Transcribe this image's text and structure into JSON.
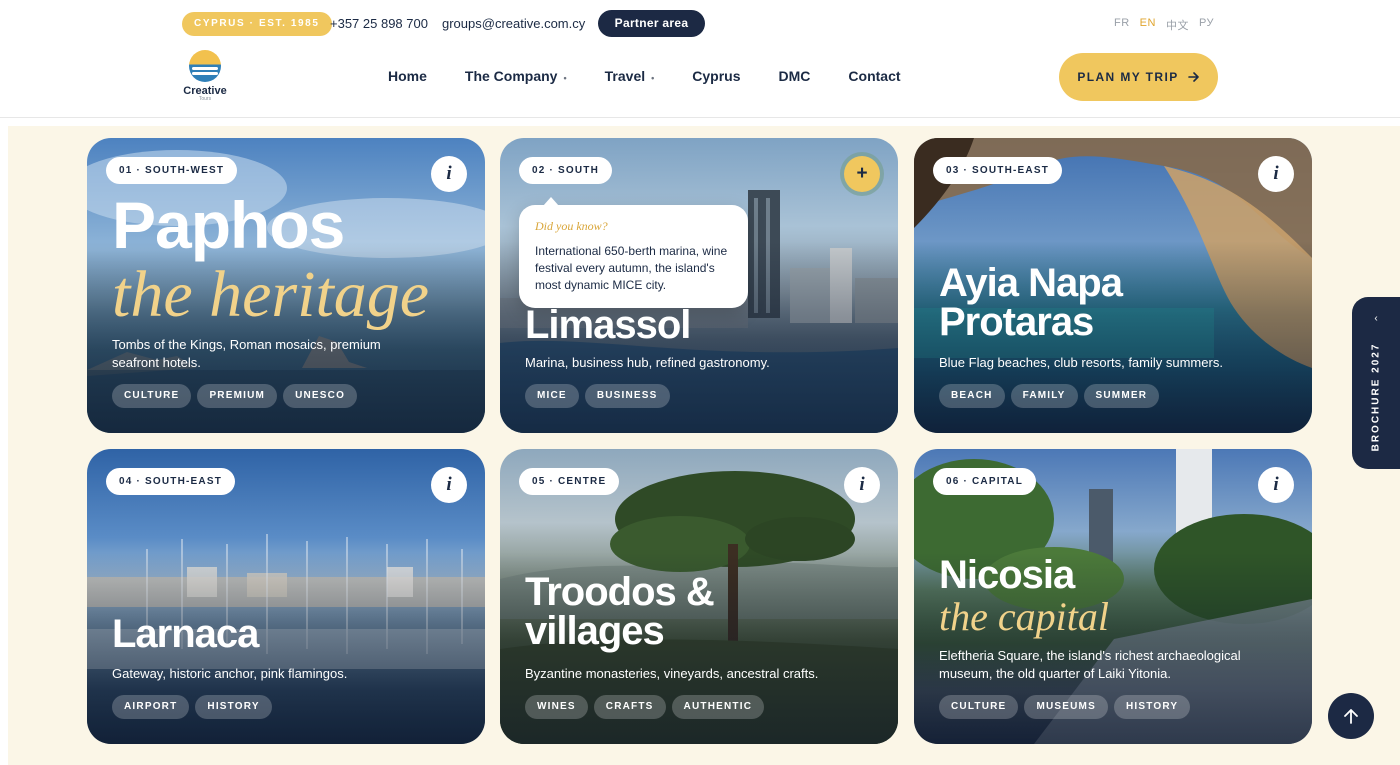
{
  "header": {
    "badge": "CYPRUS · EST. 1985",
    "phone": "+357 25 898 700",
    "email": "groups@creative.com.cy",
    "partner_label": "Partner area",
    "languages": [
      {
        "code": "FR",
        "active": false
      },
      {
        "code": "EN",
        "active": true
      },
      {
        "code": "中文",
        "active": false
      },
      {
        "code": "РУ",
        "active": false
      }
    ],
    "logo": {
      "name": "Creative",
      "sub": "Tours"
    },
    "nav": [
      {
        "label": "Home",
        "has_submenu": false
      },
      {
        "label": "The Company",
        "has_submenu": true
      },
      {
        "label": "Travel",
        "has_submenu": true
      },
      {
        "label": "Cyprus",
        "has_submenu": false
      },
      {
        "label": "DMC",
        "has_submenu": false
      },
      {
        "label": "Contact",
        "has_submenu": false
      }
    ],
    "cta_label": "PLAN MY TRIP",
    "cta_icon": "arrow-right-icon"
  },
  "cards": [
    {
      "tag": "01 · SOUTH-WEST",
      "title": "Paphos",
      "script": "the heritage",
      "desc": "Tombs of the Kings, Roman mosaics, premium seafront hotels.",
      "chips": [
        "CULTURE",
        "PREMIUM",
        "UNESCO"
      ],
      "action_icon": "info-icon",
      "action_glyph": "i"
    },
    {
      "tag": "02 · SOUTH",
      "title": "Limassol",
      "script": "",
      "desc": "Marina, business hub, refined gastronomy.",
      "chips": [
        "MICE",
        "BUSINESS"
      ],
      "action_icon": "plus-icon",
      "action_glyph": "+",
      "tooltip": {
        "heading": "Did you know?",
        "body": "International 650-berth marina, wine festival every autumn, the island's most dynamic MICE city."
      }
    },
    {
      "tag": "03 · SOUTH-EAST",
      "title": "Ayia Napa Protaras",
      "script": "",
      "desc": "Blue Flag beaches, club resorts, family summers.",
      "chips": [
        "BEACH",
        "FAMILY",
        "SUMMER"
      ],
      "action_icon": "info-icon",
      "action_glyph": "i"
    },
    {
      "tag": "04 · SOUTH-EAST",
      "title": "Larnaca",
      "script": "",
      "desc": "Gateway, historic anchor, pink flamingos.",
      "chips": [
        "AIRPORT",
        "HISTORY"
      ],
      "action_icon": "info-icon",
      "action_glyph": "i"
    },
    {
      "tag": "05 · CENTRE",
      "title": "Troodos & villages",
      "script": "",
      "desc": "Byzantine monasteries, vineyards, ancestral crafts.",
      "chips": [
        "WINES",
        "CRAFTS",
        "AUTHENTIC"
      ],
      "action_icon": "info-icon",
      "action_glyph": "i"
    },
    {
      "tag": "06 · CAPITAL",
      "title": "Nicosia",
      "script": "the capital",
      "desc": "Eleftheria Square, the island's richest archaeological museum, the old quarter of Laiki Yitonia.",
      "chips": [
        "CULTURE",
        "MUSEUMS",
        "HISTORY"
      ],
      "action_icon": "info-icon",
      "action_glyph": "i"
    }
  ],
  "brochure_tab": {
    "label": "BROCHURE 2027",
    "icon": "chevron-left-icon"
  },
  "scroll_top": {
    "icon": "arrow-up-icon"
  }
}
